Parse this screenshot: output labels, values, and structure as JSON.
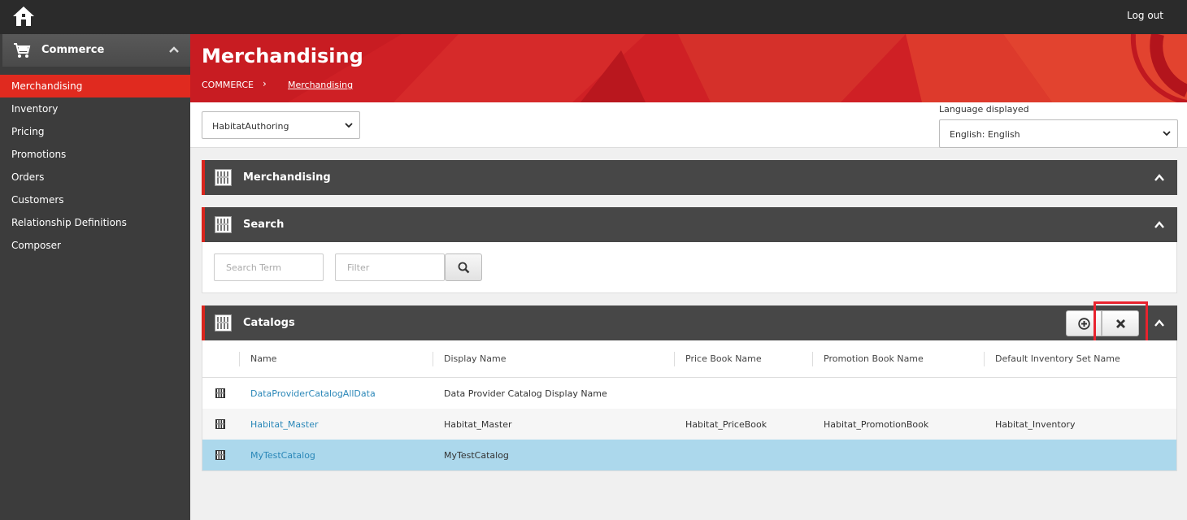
{
  "topbar": {
    "logout_label": "Log out"
  },
  "sidebar": {
    "header": "Commerce",
    "items": [
      {
        "label": "Merchandising",
        "active": true
      },
      {
        "label": "Inventory"
      },
      {
        "label": "Pricing"
      },
      {
        "label": "Promotions"
      },
      {
        "label": "Orders"
      },
      {
        "label": "Customers"
      },
      {
        "label": "Relationship Definitions"
      },
      {
        "label": "Composer"
      }
    ]
  },
  "banner": {
    "title": "Merchandising",
    "breadcrumb_root": "COMMERCE",
    "breadcrumb_sep": "›",
    "breadcrumb_current": "Merchandising"
  },
  "toolbar": {
    "environment": "HabitatAuthoring",
    "language_label": "Language displayed",
    "language": "English: English"
  },
  "panels": {
    "merchandising": "Merchandising",
    "search": "Search",
    "catalogs": "Catalogs"
  },
  "search": {
    "term_placeholder": "Search Term",
    "filter_placeholder": "Filter"
  },
  "table": {
    "columns": [
      "Name",
      "Display Name",
      "Price Book Name",
      "Promotion Book Name",
      "Default Inventory Set Name"
    ],
    "rows": [
      {
        "name": "DataProviderCatalogAllData",
        "display": "Data Provider Catalog Display Name",
        "pricebook": "",
        "promobook": "",
        "inventory": ""
      },
      {
        "name": "Habitat_Master",
        "display": "Habitat_Master",
        "pricebook": "Habitat_PriceBook",
        "promobook": "Habitat_PromotionBook",
        "inventory": "Habitat_Inventory"
      },
      {
        "name": "MyTestCatalog",
        "display": "MyTestCatalog",
        "pricebook": "",
        "promobook": "",
        "inventory": ""
      }
    ]
  },
  "colors": {
    "accent": "#e02a1f",
    "banner": "#cf2025",
    "panel_header": "#474747",
    "selected_row": "#acd8ec",
    "link": "#2a87b8"
  }
}
